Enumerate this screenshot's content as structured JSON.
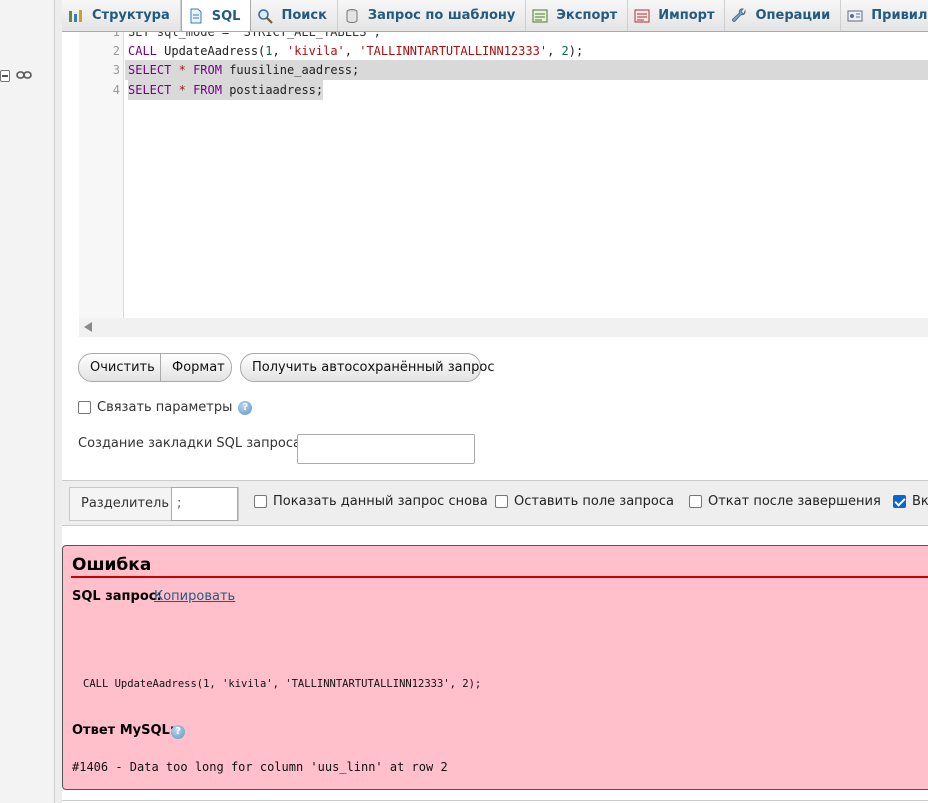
{
  "tabs": [
    {
      "label": "Структура",
      "icon": "structure-icon",
      "active": false
    },
    {
      "label": "SQL",
      "icon": "sql-icon",
      "active": true
    },
    {
      "label": "Поиск",
      "icon": "search-icon",
      "active": false
    },
    {
      "label": "Запрос по шаблону",
      "icon": "query-icon",
      "active": false
    },
    {
      "label": "Экспорт",
      "icon": "export-icon",
      "active": false
    },
    {
      "label": "Импорт",
      "icon": "import-icon",
      "active": false
    },
    {
      "label": "Операции",
      "icon": "operations-icon",
      "active": false
    },
    {
      "label": "Привилегии",
      "icon": "privileges-icon",
      "active": false
    }
  ],
  "editor": {
    "lines": [
      {
        "num": "1",
        "text": "SET sql_mode = 'STRICT_ALL_TABLES';"
      },
      {
        "num": "2",
        "text": "CALL UpdateAadress(1, 'kivila', 'TALLINNTARTUTALLINN12333', 2);"
      },
      {
        "num": "3",
        "text": "SELECT * FROM fuusiline_aadress;"
      },
      {
        "num": "4",
        "text": "SELECT * FROM postiaadress;"
      }
    ]
  },
  "buttons": {
    "clear": "Очистить",
    "format": "Формат",
    "autosaved": "Получить автосохранённый запрос"
  },
  "bind_params": {
    "label": "Связать параметры",
    "checked": false
  },
  "bookmark": {
    "label": "Создание закладки SQL запроса:",
    "value": ""
  },
  "delimiter": {
    "label": "Разделитель",
    "value": ";"
  },
  "options": [
    {
      "label": "Показать данный запрос снова",
      "checked": false
    },
    {
      "label": "Оставить поле запроса",
      "checked": false
    },
    {
      "label": "Откат после завершения",
      "checked": false
    },
    {
      "label": "Вк",
      "checked": true
    }
  ],
  "error": {
    "title": "Ошибка",
    "sql_label": "SQL запрос:",
    "copy_link": "Копировать",
    "query": "CALL UpdateAadress(1, 'kivila', 'TALLINNTARTUTALLINN12333', 2);",
    "mysql_label": "Ответ MySQL:",
    "message": "#1406 - Data too long for column 'uus_linn' at row 2"
  },
  "colors": {
    "tab_text": "#235a81",
    "error_bg": "#ffc0cb",
    "error_rule": "#cc0000",
    "keyword": "#770088",
    "string": "#aa1111"
  }
}
